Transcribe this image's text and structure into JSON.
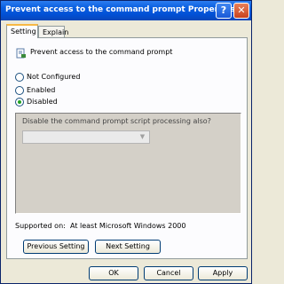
{
  "window": {
    "title": "Prevent access to the command prompt Properties",
    "help_glyph": "?",
    "close_glyph": "✕"
  },
  "tabs": [
    {
      "label": "Setting",
      "selected": true
    },
    {
      "label": "Explain",
      "selected": false
    }
  ],
  "policy": {
    "name": "Prevent access to the command prompt",
    "icon": "policy-document-icon"
  },
  "state": {
    "options": [
      {
        "label": "Not Configured",
        "checked": false
      },
      {
        "label": "Enabled",
        "checked": false
      },
      {
        "label": "Disabled",
        "checked": true
      }
    ]
  },
  "options_box": {
    "label": "Disable the command prompt script processing also?",
    "dropdown_value": "",
    "enabled": false
  },
  "supported": {
    "label": "Supported on:",
    "value": "At least Microsoft Windows 2000"
  },
  "nav": {
    "previous": "Previous Setting",
    "next": "Next Setting"
  },
  "footer": {
    "ok": "OK",
    "cancel": "Cancel",
    "apply": "Apply"
  },
  "colors": {
    "titlebar": "#0a5fe0",
    "dialog_bg": "#ece9d8",
    "disabled_area": "#d4d0c8"
  }
}
